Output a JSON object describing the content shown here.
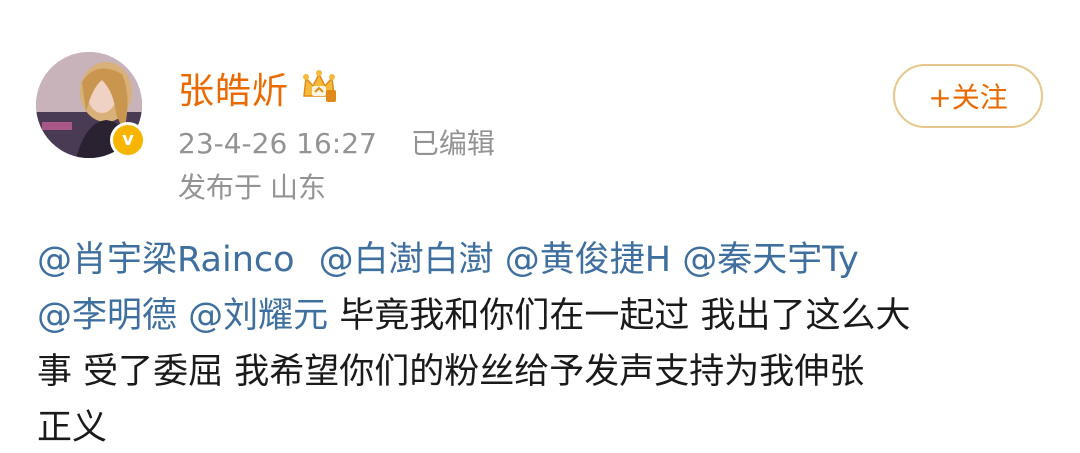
{
  "post": {
    "author": {
      "name": "张皓炘",
      "avatar_icon": "avatar-image",
      "badge_icon": "verified-v-icon",
      "badge_text": "v",
      "crown_icon": "vip-crown-icon"
    },
    "timestamp": "23-4-26 16:27",
    "edited_label": "已编辑",
    "location_prefix": "发布于",
    "location": "山东",
    "follow_label": "+关注",
    "mentions": [
      "@肖宇梁Rainco",
      "@白澍白澍",
      "@黄俊捷H",
      "@秦天宇Ty",
      "@李明德",
      "@刘耀元"
    ],
    "body_line1_text": "毕竟我和你们在一起过 我出了这么大",
    "body_line2_text": "事 受了委屈 我希望你们的粉丝给予发声支持为我伸张",
    "body_line3_text": "正义"
  },
  "colors": {
    "username": "#ea6a00",
    "mention": "#3f6f9f",
    "meta": "#939393",
    "follow_border": "#e8c58a",
    "badge": "#f7b500"
  }
}
